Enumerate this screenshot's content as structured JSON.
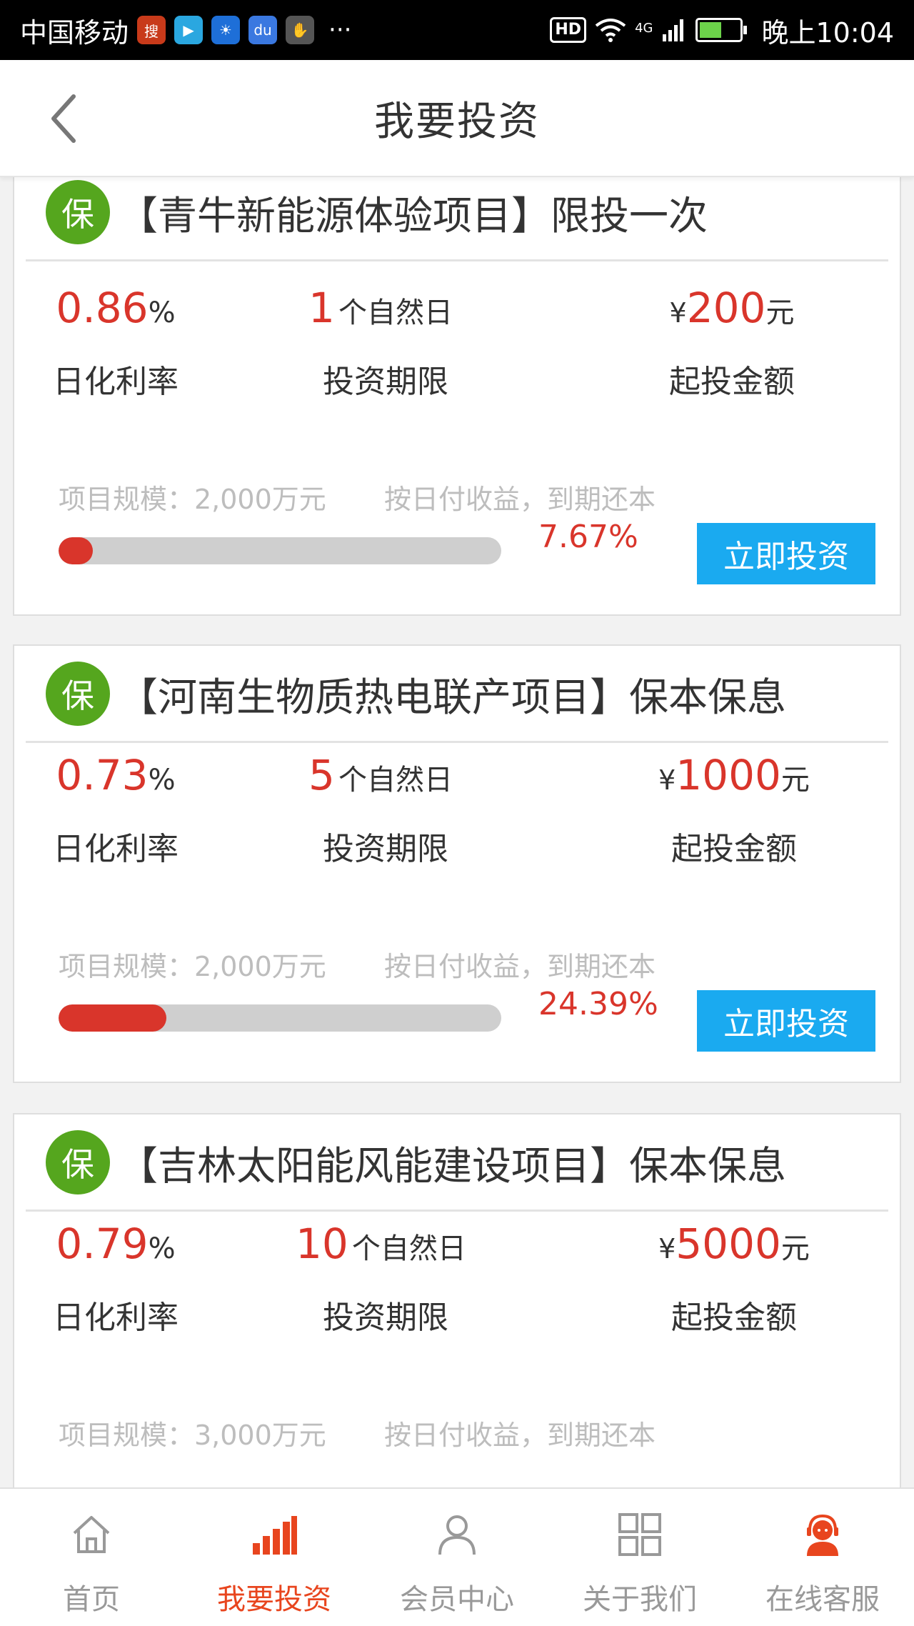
{
  "status_bar": {
    "carrier": "中国移动",
    "apps": [
      {
        "icon": "sohu-app-icon",
        "color": "#c83a1a"
      },
      {
        "icon": "video-app-icon",
        "color": "#2aa7e0"
      },
      {
        "icon": "bulb-app-icon",
        "color": "#1e6fd8"
      },
      {
        "icon": "baidu-app-icon",
        "color": "#3a78e0"
      },
      {
        "icon": "hand-app-icon",
        "color": "#555555"
      }
    ],
    "more": "···",
    "hd": "HD",
    "network": "4G",
    "time": "晚上10:04"
  },
  "header": {
    "title": "我要投资"
  },
  "colors": {
    "accent_red": "#d9352b",
    "button_blue": "#1aaaf0",
    "badge_green": "#55a61e",
    "tab_active": "#e8451e"
  },
  "projects": [
    {
      "badge": "保",
      "title": "【青牛新能源体验项目】限投一次",
      "rate_value": "0.86",
      "rate_unit": "%",
      "rate_label": "日化利率",
      "term_value": "1",
      "term_unit": "个自然日",
      "term_label": "投资期限",
      "amount_currency": "¥",
      "amount_value": "200",
      "amount_unit": "元",
      "amount_label": "起投金额",
      "scale": "项目规模：2,000万元",
      "repayment": "按日付收益，到期还本",
      "progress": 7.67,
      "progress_text": "7.67%",
      "button": "立即投资"
    },
    {
      "badge": "保",
      "title": "【河南生物质热电联产项目】保本保息",
      "rate_value": "0.73",
      "rate_unit": "%",
      "rate_label": "日化利率",
      "term_value": "5",
      "term_unit": "个自然日",
      "term_label": "投资期限",
      "amount_currency": "¥",
      "amount_value": "1000",
      "amount_unit": "元",
      "amount_label": "起投金额",
      "scale": "项目规模：2,000万元",
      "repayment": "按日付收益，到期还本",
      "progress": 24.39,
      "progress_text": "24.39%",
      "button": "立即投资"
    },
    {
      "badge": "保",
      "title": "【吉林太阳能风能建设项目】保本保息",
      "rate_value": "0.79",
      "rate_unit": "%",
      "rate_label": "日化利率",
      "term_value": "10",
      "term_unit": "个自然日",
      "term_label": "投资期限",
      "amount_currency": "¥",
      "amount_value": "5000",
      "amount_unit": "元",
      "amount_label": "起投金额",
      "scale": "项目规模：3,000万元",
      "repayment": "按日付收益，到期还本"
    }
  ],
  "tabs": [
    {
      "label": "首页",
      "icon": "home-icon",
      "active": false
    },
    {
      "label": "我要投资",
      "icon": "bar-chart-icon",
      "active": true
    },
    {
      "label": "会员中心",
      "icon": "user-icon",
      "active": false
    },
    {
      "label": "关于我们",
      "icon": "grid-icon",
      "active": false
    },
    {
      "label": "在线客服",
      "icon": "customer-service-icon",
      "active": false
    }
  ]
}
